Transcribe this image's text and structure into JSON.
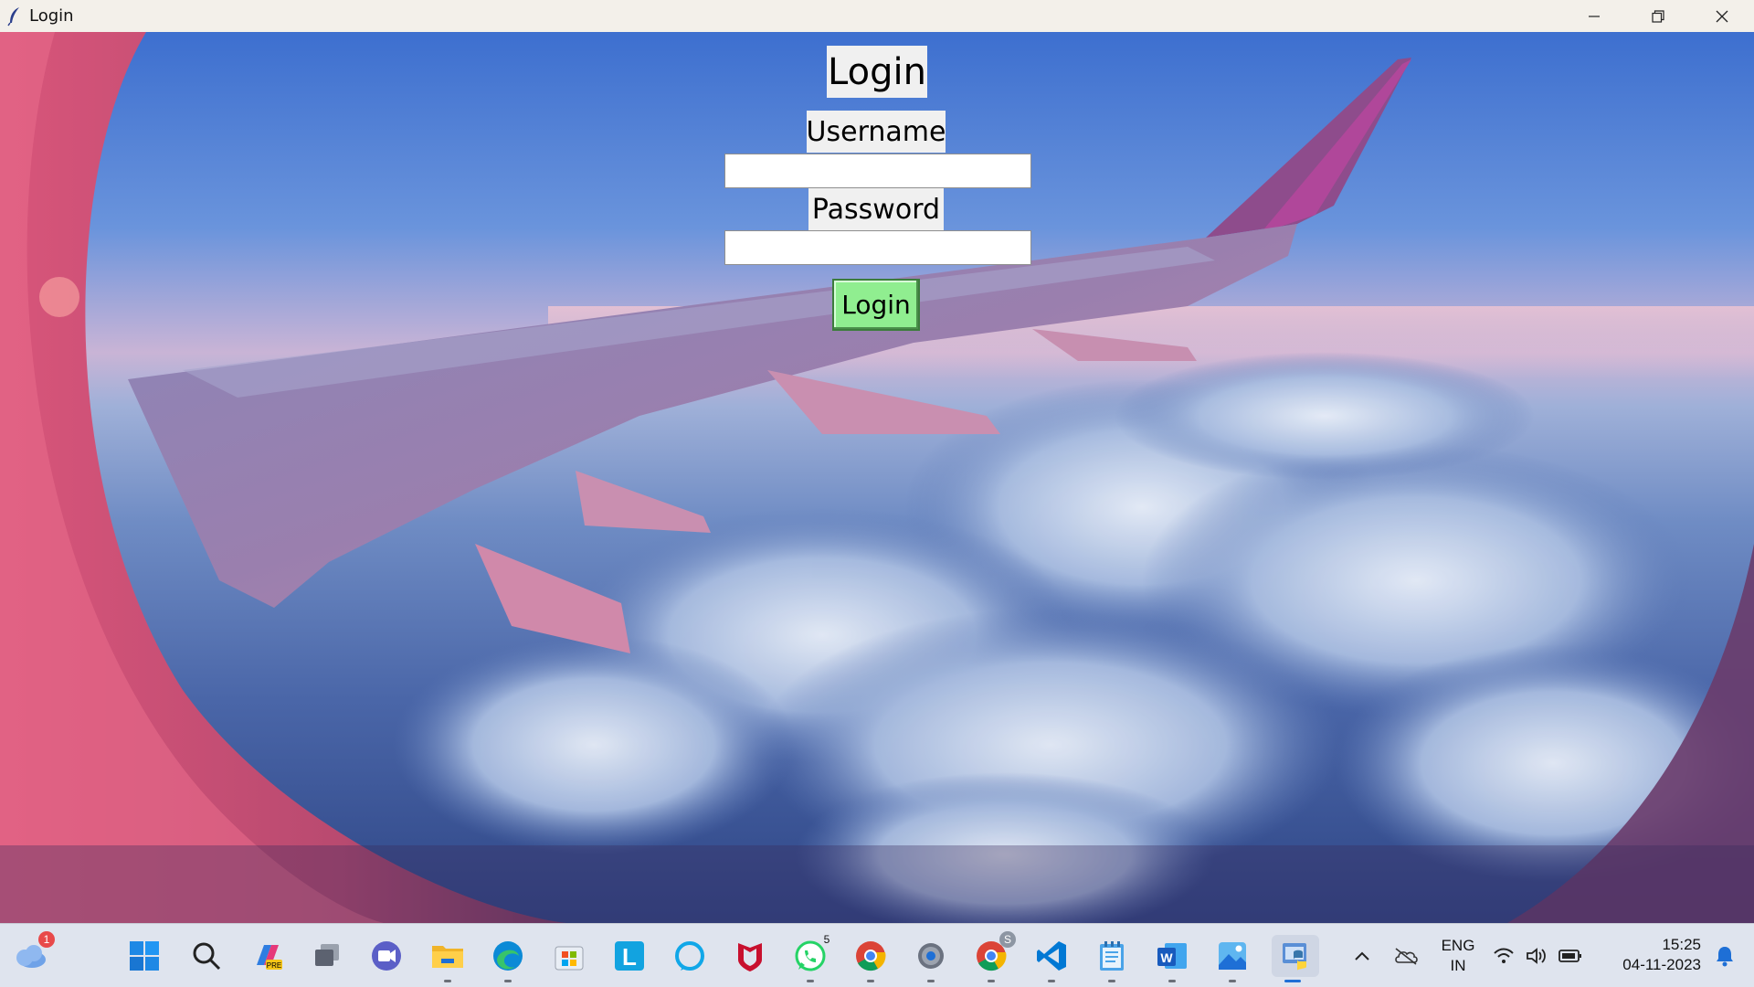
{
  "window": {
    "title": "Login",
    "controls": {
      "minimize": "minimize-icon",
      "restore": "restore-icon",
      "close": "close-icon"
    }
  },
  "form": {
    "title": "Login",
    "username_label": "Username",
    "username_value": "",
    "password_label": "Password",
    "password_value": "",
    "login_button": "Login",
    "login_button_color": "#90ee90"
  },
  "taskbar": {
    "weather_badge": "1",
    "apps": [
      {
        "name": "weather-widget-icon"
      },
      {
        "name": "start-icon"
      },
      {
        "name": "search-icon"
      },
      {
        "name": "copilot-pre-icon"
      },
      {
        "name": "task-view-icon"
      },
      {
        "name": "teams-icon"
      },
      {
        "name": "file-explorer-icon"
      },
      {
        "name": "edge-icon"
      },
      {
        "name": "store-icon"
      },
      {
        "name": "l-app-icon"
      },
      {
        "name": "alexa-icon"
      },
      {
        "name": "mcafee-icon"
      },
      {
        "name": "whatsapp-icon",
        "badge": "5"
      },
      {
        "name": "chrome-icon"
      },
      {
        "name": "settings-icon"
      },
      {
        "name": "chrome-profile-icon"
      },
      {
        "name": "vscode-icon"
      },
      {
        "name": "notepad-icon"
      },
      {
        "name": "word-icon"
      },
      {
        "name": "photos-icon"
      },
      {
        "name": "python-icon"
      }
    ],
    "whatsapp_badge": "5",
    "chrome_profile_badge": "S",
    "tray": {
      "language_line1": "ENG",
      "language_line2": "IN",
      "time": "15:25",
      "date": "04-11-2023"
    }
  }
}
